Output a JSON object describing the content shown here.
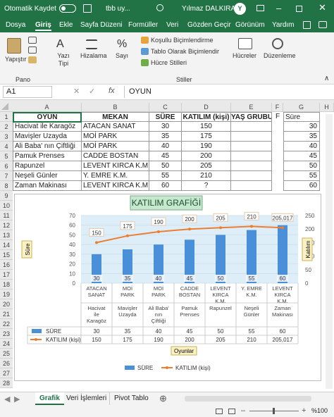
{
  "titlebar": {
    "autosave_label": "Otomatik Kaydet",
    "toggle_state": "off",
    "file_name": "tbb uy...",
    "user_name": "Yılmaz DALKIRAN",
    "avatar_initial": "Y"
  },
  "ribbon_tabs": [
    "Dosya",
    "Giriş",
    "Ekle",
    "Sayfa Düzeni",
    "Formüller",
    "Veri",
    "Gözden Geçir",
    "Görünüm",
    "Yardım"
  ],
  "ribbon": {
    "paste_label": "Yapıştır",
    "font_label": "Yazı Tipi",
    "align_label": "Hizalama",
    "number_label": "Sayı",
    "cond_format": "Koşullu Biçimlendirme",
    "table_format": "Tablo Olarak Biçimlendir",
    "cell_styles": "Hücre Stilleri",
    "cells_label": "Hücreler",
    "edit_label": "Düzenleme",
    "group_clipboard": "Pano",
    "group_styles": "Stiller"
  },
  "formula_bar": {
    "name_box": "A1",
    "fx": "fx",
    "value": "OYUN"
  },
  "columns": [
    "A",
    "B",
    "C",
    "D",
    "E",
    "F",
    "G",
    "H"
  ],
  "row_numbers": [
    "1",
    "2",
    "3",
    "4",
    "5",
    "6",
    "7",
    "8",
    "9",
    "10",
    "11",
    "12",
    "13",
    "14",
    "15",
    "16",
    "17",
    "18",
    "19",
    "20",
    "21",
    "22",
    "23",
    "24",
    "25",
    "26",
    "27",
    "28"
  ],
  "table": {
    "headers": [
      "OYUN",
      "MEKAN",
      "SÜRE",
      "KATILIM (kişi)",
      "YAŞ GRUBU"
    ],
    "rows": [
      [
        "Hacivat ile Karagöz",
        "ATACAN SANAT",
        "30",
        "150",
        ""
      ],
      [
        "Mavişler Uzayda",
        "MOİ PARK",
        "35",
        "175",
        ""
      ],
      [
        "Ali Baba' nın Çiftliği",
        "MOİ PARK",
        "40",
        "190",
        ""
      ],
      [
        "Pamuk Prenses",
        "CADDE BOSTAN",
        "45",
        "200",
        ""
      ],
      [
        "Rapunzel",
        "LEVENT KIRCA K.M.",
        "50",
        "205",
        ""
      ],
      [
        "Neşeli Günler",
        "Y. EMRE K.M.",
        "55",
        "210",
        ""
      ],
      [
        "Zaman Makinası",
        "LEVENT KIRCA K.M.",
        "60",
        "?",
        ""
      ]
    ],
    "g_header": "Süre",
    "g_values": [
      "30",
      "35",
      "40",
      "45",
      "50",
      "55",
      "60"
    ]
  },
  "chart_data": {
    "type": "bar",
    "title": "KATILIM GRAFİĞİ",
    "categories": [
      [
        "ATACAN SANAT",
        "Hacivat ile Karagöz"
      ],
      [
        "MOİ PARK",
        "Mavişler Uzayda"
      ],
      [
        "MOİ PARK",
        "Ali Baba' nın Çiftliği"
      ],
      [
        "CADDE BOSTAN",
        "Pamuk Prenses"
      ],
      [
        "LEVENT KIRCA K.M.",
        "Rapunzel"
      ],
      [
        "Y. EMRE K.M.",
        "Neşeli Günler"
      ],
      [
        "LEVENT KIRCA K.M.",
        "Zaman Makinası"
      ]
    ],
    "series": [
      {
        "name": "SÜRE",
        "type": "bar",
        "axis": "left",
        "values": [
          30,
          35,
          40,
          45,
          50,
          55,
          60
        ],
        "labels": [
          "30",
          "35",
          "40",
          "45",
          "50",
          "55",
          "60"
        ],
        "color": "#4a90d9"
      },
      {
        "name": "KATILIM (kişi)",
        "type": "line",
        "axis": "right",
        "values": [
          150,
          175,
          190,
          200,
          205,
          210,
          205.017
        ],
        "labels": [
          "150",
          "175",
          "190",
          "200",
          "205",
          "210",
          "205,017"
        ],
        "color": "#ed7d31"
      }
    ],
    "ylabel": "Süre",
    "y2label": "Katılım",
    "xlabel": "Oyunlar",
    "ylim": [
      0,
      70
    ],
    "yticks": [
      "0",
      "10",
      "20",
      "30",
      "40",
      "50",
      "60",
      "70"
    ],
    "y2lim": [
      0,
      250
    ],
    "y2ticks": [
      "0",
      "50",
      "100",
      "150",
      "200",
      "250"
    ],
    "legend": [
      "SÜRE",
      "KATILIM (kişi)"
    ],
    "legend_position": "bottom",
    "grid": true,
    "plot_background": "#ddeef8"
  },
  "sheet_tabs": [
    "Grafik",
    "Veri İşlemleri",
    "Pivot Tablo"
  ],
  "status": {
    "zoom": "%100"
  },
  "colors": {
    "excel_green": "#217346",
    "bar_blue": "#4a90d9",
    "line_orange": "#ed7d31",
    "title_bg": "#c6e8cf"
  }
}
